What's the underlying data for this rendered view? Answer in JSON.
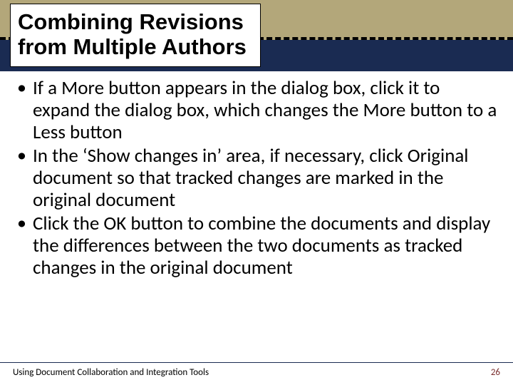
{
  "title": "Combining Revisions from Multiple Authors",
  "bullets": [
    "If a More button appears in the dialog box, click it to expand the dialog box, which changes the More button to a Less button",
    "In the ‘Show changes in’ area, if necessary, click Original document so that tracked changes are marked in the original document",
    "Click the OK button to combine the documents and display the differences between the two documents as tracked changes in the original document"
  ],
  "footer": {
    "text": "Using Document Collaboration and Integration Tools",
    "page": "26"
  }
}
